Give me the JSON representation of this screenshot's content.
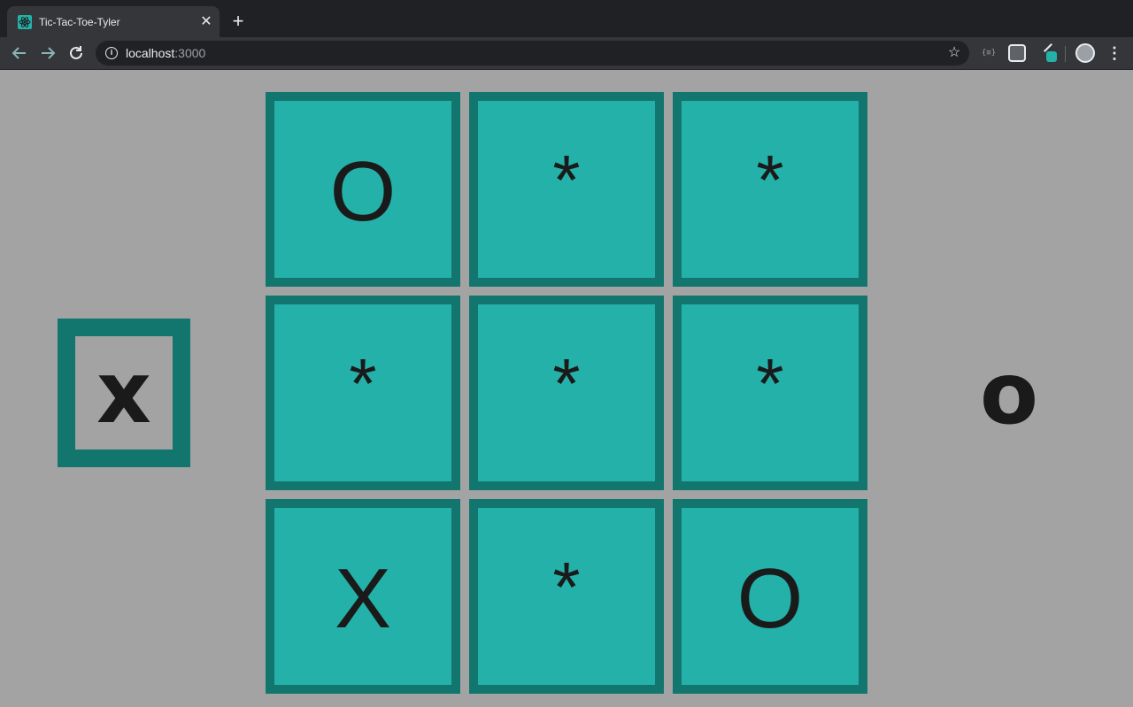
{
  "browser": {
    "tab_title": "Tic-Tac-Toe-Tyler",
    "tab_close": "✕",
    "new_tab": "+",
    "url_host": "localhost",
    "url_port": ":3000",
    "back_icon": "arrow-left-icon",
    "forward_icon": "arrow-right-icon",
    "reload_icon": "reload-icon",
    "extension_label": "{≡}"
  },
  "game": {
    "current_player": "x",
    "other_player": "o",
    "board": [
      [
        "O",
        "*",
        "*"
      ],
      [
        "*",
        "*",
        "*"
      ],
      [
        "X",
        "*",
        "O"
      ]
    ]
  },
  "colors": {
    "background": "#a3a3a3",
    "cell_border": "#12766f",
    "cell_fill": "#24b1a9",
    "mark": "#1a1a1a"
  }
}
